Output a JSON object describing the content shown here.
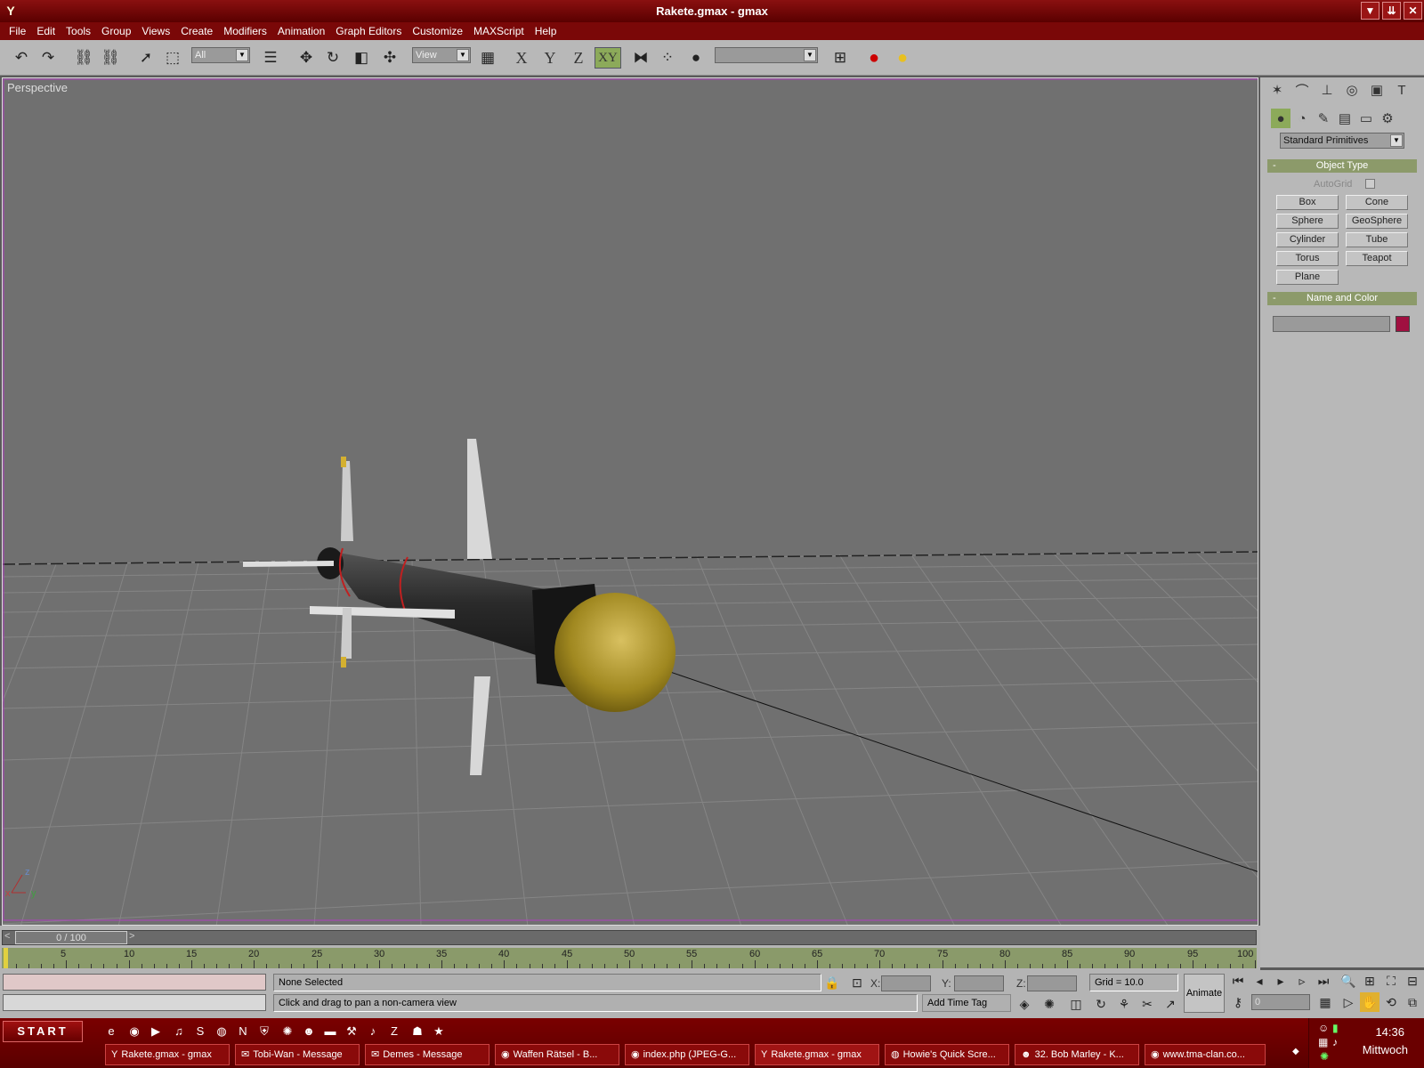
{
  "window": {
    "title": "Rakete.gmax - gmax",
    "controls": [
      "▼",
      "⇊",
      "✕"
    ]
  },
  "menu": [
    "File",
    "Edit",
    "Tools",
    "Group",
    "Views",
    "Create",
    "Modifiers",
    "Animation",
    "Graph Editors",
    "Customize",
    "MAXScript",
    "Help"
  ],
  "toolbar": {
    "selection_filter": "All",
    "ref_coord": "View",
    "axes": [
      "X",
      "Y",
      "Z",
      "XY"
    ],
    "named_selection": ""
  },
  "viewport": {
    "label": "Perspective",
    "axis_labels": {
      "x": "x",
      "y": "y",
      "z": "z"
    }
  },
  "panel": {
    "category": "Standard Primitives",
    "object_type": {
      "title": "Object Type",
      "collapse": "-",
      "autogrid": "AutoGrid",
      "buttons": [
        "Box",
        "Cone",
        "Sphere",
        "GeoSphere",
        "Cylinder",
        "Tube",
        "Torus",
        "Teapot",
        "Plane"
      ]
    },
    "name_color": {
      "title": "Name and Color",
      "collapse": "-",
      "swatch": "#a01040"
    }
  },
  "timeline": {
    "frame": "0 / 100",
    "ticks": [
      "5",
      "10",
      "15",
      "20",
      "25",
      "30",
      "35",
      "40",
      "45",
      "50",
      "55",
      "60",
      "65",
      "70",
      "75",
      "80",
      "85",
      "90",
      "95",
      "100"
    ]
  },
  "status": {
    "selection": "None Selected",
    "prompt": "Click and drag to pan a non-camera view",
    "x_label": "X:",
    "y_label": "Y:",
    "z_label": "Z:",
    "grid": "Grid = 10.0",
    "add_time_tag": "Add Time Tag",
    "animate": "Animate",
    "frame_value": "0"
  },
  "taskbar": {
    "start": "START",
    "tasks": [
      "Rakete.gmax - gmax",
      "Tobi-Wan - Message",
      "Demes - Message",
      "Waffen Rätsel - B...",
      "index.php (JPEG-G...",
      "Rakete.gmax - gmax",
      "Howie's Quick Scre...",
      "32. Bob Marley - K...",
      "www.tma-clan.co..."
    ],
    "clock": "14:36",
    "day": "Mittwoch"
  }
}
